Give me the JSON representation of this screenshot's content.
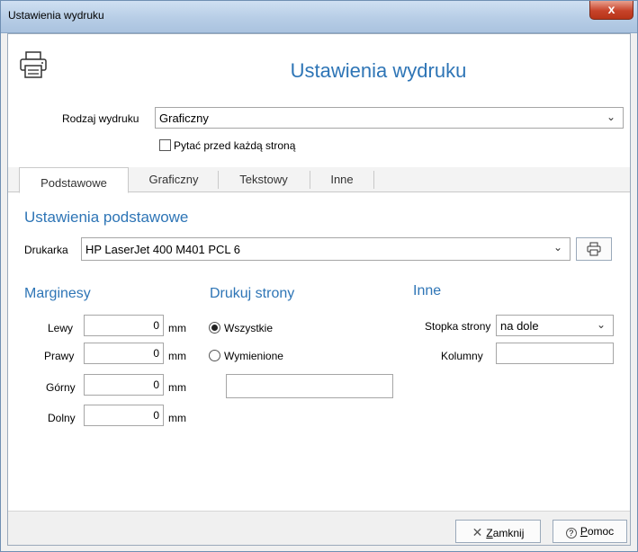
{
  "window": {
    "title": "Ustawienia wydruku",
    "close_glyph": "x"
  },
  "header": {
    "title": "Ustawienia wydruku",
    "icon": "printer-icon"
  },
  "print_type": {
    "label": "Rodzaj wydruku",
    "value": "Graficzny"
  },
  "ask_each_page": {
    "label": "Pytać przed każdą stroną",
    "checked": false
  },
  "tabs": [
    {
      "label": "Podstawowe",
      "active": true
    },
    {
      "label": "Graficzny",
      "active": false
    },
    {
      "label": "Tekstowy",
      "active": false
    },
    {
      "label": "Inne",
      "active": false
    }
  ],
  "basic": {
    "section_title": "Ustawienia podstawowe",
    "printer_label": "Drukarka",
    "printer_value": "HP LaserJet 400 M401 PCL 6",
    "printer_button_icon": "printer-icon"
  },
  "margins": {
    "title": "Marginesy",
    "unit": "mm",
    "rows": [
      {
        "label": "Lewy",
        "value": "0"
      },
      {
        "label": "Prawy",
        "value": "0"
      },
      {
        "label": "Górny",
        "value": "0"
      },
      {
        "label": "Dolny",
        "value": "0"
      }
    ]
  },
  "print_pages": {
    "title": "Drukuj strony",
    "all_label": "Wszystkie",
    "listed_label": "Wymienione",
    "selected": "all",
    "listed_value": ""
  },
  "other": {
    "title": "Inne",
    "footer_label": "Stopka strony",
    "footer_value": "na dole",
    "columns_label": "Kolumny",
    "columns_value": ""
  },
  "footer": {
    "close_key": "Z",
    "close_rest": "amknij",
    "help_key": "P",
    "help_rest": "omoc"
  },
  "colors": {
    "accent": "#2e75b6"
  }
}
